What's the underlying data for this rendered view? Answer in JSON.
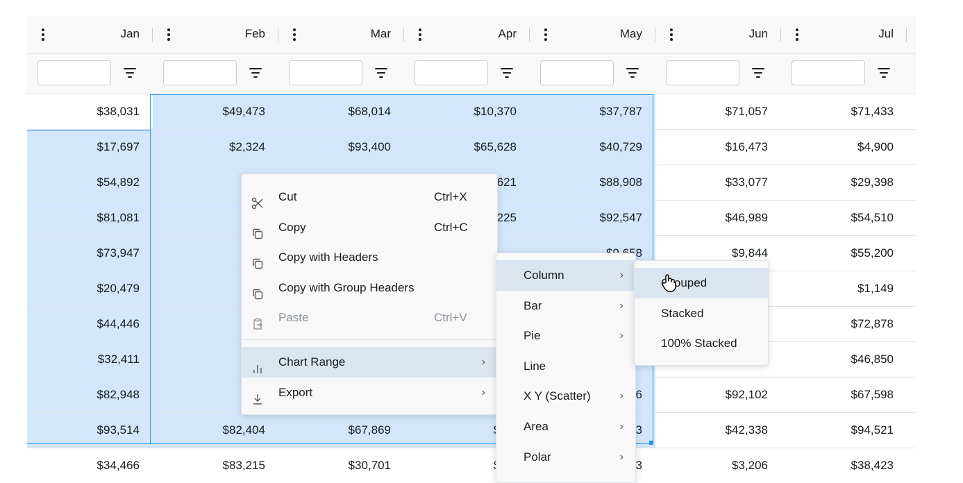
{
  "columns": [
    "Jan",
    "Feb",
    "Mar",
    "Apr",
    "May",
    "Jun",
    "Jul"
  ],
  "rows": [
    [
      "$38,031",
      "$49,473",
      "$68,014",
      "$10,370",
      "$37,787",
      "$71,057",
      "$71,433"
    ],
    [
      "$17,697",
      "$2,324",
      "$93,400",
      "$65,628",
      "$40,729",
      "$16,473",
      "$4,900"
    ],
    [
      "$54,892",
      "$57,",
      "",
      ",621",
      "$88,908",
      "$33,077",
      "$29,398"
    ],
    [
      "$81,081",
      "$16",
      "",
      "225",
      "$92,547",
      "$46,989",
      "$54,510"
    ],
    [
      "$73,947",
      "$41,",
      "",
      "",
      "$9,658",
      "$9,844",
      "$55,200"
    ],
    [
      "$20,479",
      "$2,",
      "",
      "",
      "",
      "",
      "$1,149"
    ],
    [
      "$44,446",
      "$34",
      "",
      "",
      "",
      "",
      "$72,878"
    ],
    [
      "$32,411",
      "$95",
      "",
      "",
      "",
      "",
      "$46,850"
    ],
    [
      "$82,948",
      "$7",
      "",
      "",
      "6",
      "$92,102",
      "$67,598"
    ],
    [
      "$93,514",
      "$82,404",
      "$67,869",
      "$19,",
      "3",
      "$42,338",
      "$94,521"
    ],
    [
      "$34,466",
      "$83,215",
      "$30,701",
      "$70,",
      "3",
      "$3,206",
      "$38,423"
    ]
  ],
  "context_menu": {
    "items": [
      {
        "label": "Cut",
        "shortcut": "Ctrl+X",
        "icon": "scissors-icon"
      },
      {
        "label": "Copy",
        "shortcut": "Ctrl+C",
        "icon": "copy-icon"
      },
      {
        "label": "Copy with Headers",
        "shortcut": "",
        "icon": "copy-icon"
      },
      {
        "label": "Copy with Group Headers",
        "shortcut": "",
        "icon": "copy-icon"
      },
      {
        "label": "Paste",
        "shortcut": "Ctrl+V",
        "icon": "paste-icon",
        "disabled": true
      },
      {
        "label": "Chart Range",
        "shortcut": "",
        "icon": "chart-icon",
        "submenu": true,
        "active": true
      },
      {
        "label": "Export",
        "shortcut": "",
        "icon": "download-icon",
        "submenu": true
      }
    ]
  },
  "chart_menu": {
    "items": [
      {
        "label": "Column",
        "submenu": true,
        "active": true
      },
      {
        "label": "Bar",
        "submenu": true
      },
      {
        "label": "Pie",
        "submenu": true
      },
      {
        "label": "Line",
        "submenu": false
      },
      {
        "label": "X Y (Scatter)",
        "submenu": true
      },
      {
        "label": "Area",
        "submenu": true
      },
      {
        "label": "Polar",
        "submenu": true
      }
    ]
  },
  "column_menu": {
    "items": [
      {
        "label": "Grouped",
        "active": true
      },
      {
        "label": "Stacked"
      },
      {
        "label": "100% Stacked"
      }
    ]
  },
  "colors": {
    "selection": "#d3e6fb",
    "selection_border": "#2196f3",
    "menu_bg": "#f8f8f8",
    "menu_active": "#dbe5ef"
  }
}
